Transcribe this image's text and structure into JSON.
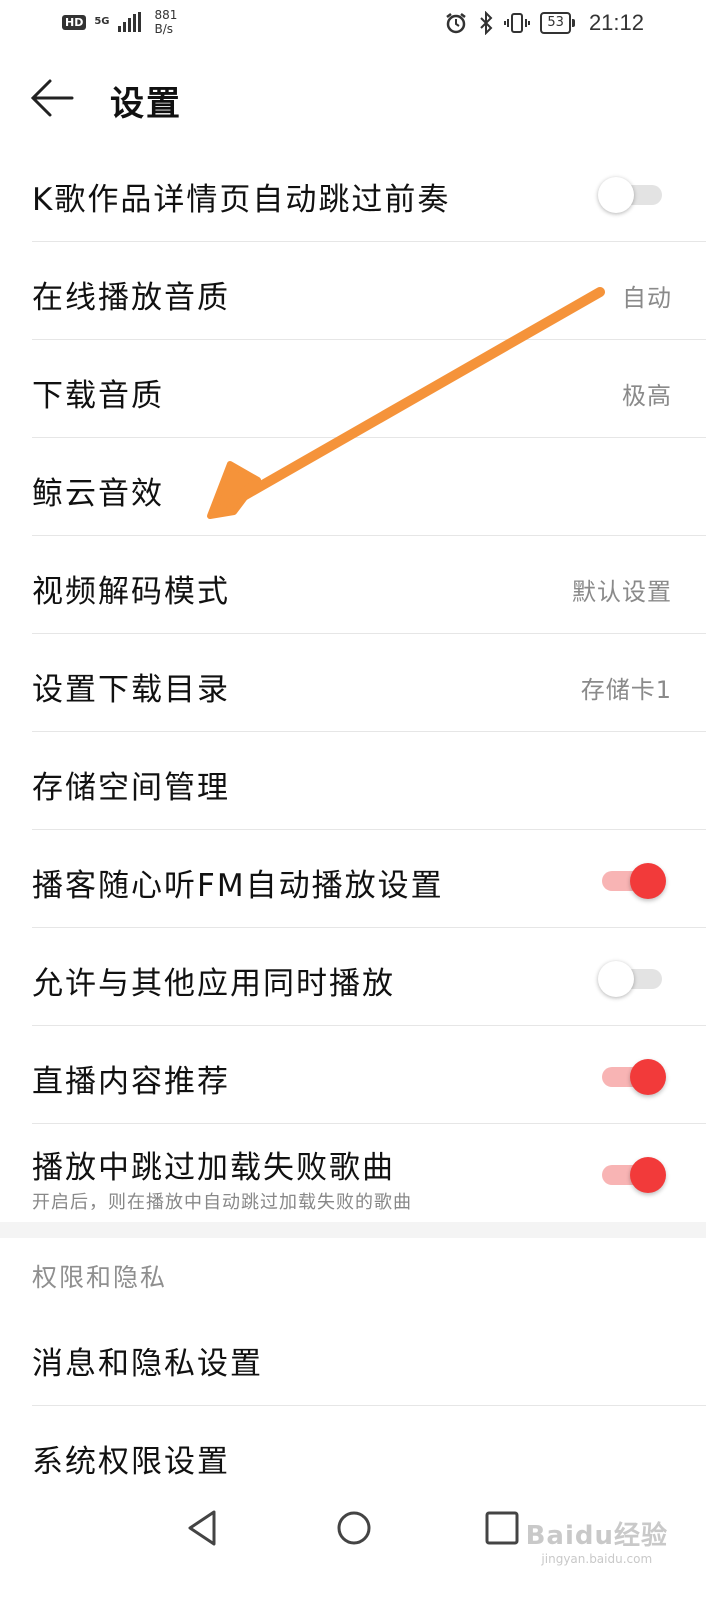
{
  "status_bar": {
    "hd": "HD",
    "signal": "5G",
    "net_speed_value": "881",
    "net_speed_unit": "B/s",
    "battery": "53",
    "time": "21:12"
  },
  "header": {
    "title": "设置"
  },
  "settings": [
    {
      "label": "K歌作品详情页自动跳过前奏",
      "toggle": false
    },
    {
      "label": "在线播放音质",
      "value": "自动"
    },
    {
      "label": "下载音质",
      "value": "极高"
    },
    {
      "label": "鲸云音效"
    },
    {
      "label": "视频解码模式",
      "value": "默认设置"
    },
    {
      "label": "设置下载目录",
      "value": "存储卡1"
    },
    {
      "label": "存储空间管理"
    },
    {
      "label": "播客随心听FM自动播放设置",
      "toggle": true
    },
    {
      "label": "允许与其他应用同时播放",
      "toggle": false
    },
    {
      "label": "直播内容推荐",
      "toggle": true
    },
    {
      "label": "播放中跳过加载失败歌曲",
      "sub": "开启后，则在播放中自动跳过加载失败的歌曲",
      "toggle": true
    }
  ],
  "privacy_section": {
    "header": "权限和隐私",
    "items": [
      {
        "label": "消息和隐私设置"
      },
      {
        "label": "系统权限设置"
      }
    ]
  },
  "colors": {
    "accent": "#f23a3a",
    "annotation_arrow": "#f5933a"
  },
  "watermark": {
    "main": "Baidu经验",
    "sub": "jingyan.baidu.com"
  }
}
